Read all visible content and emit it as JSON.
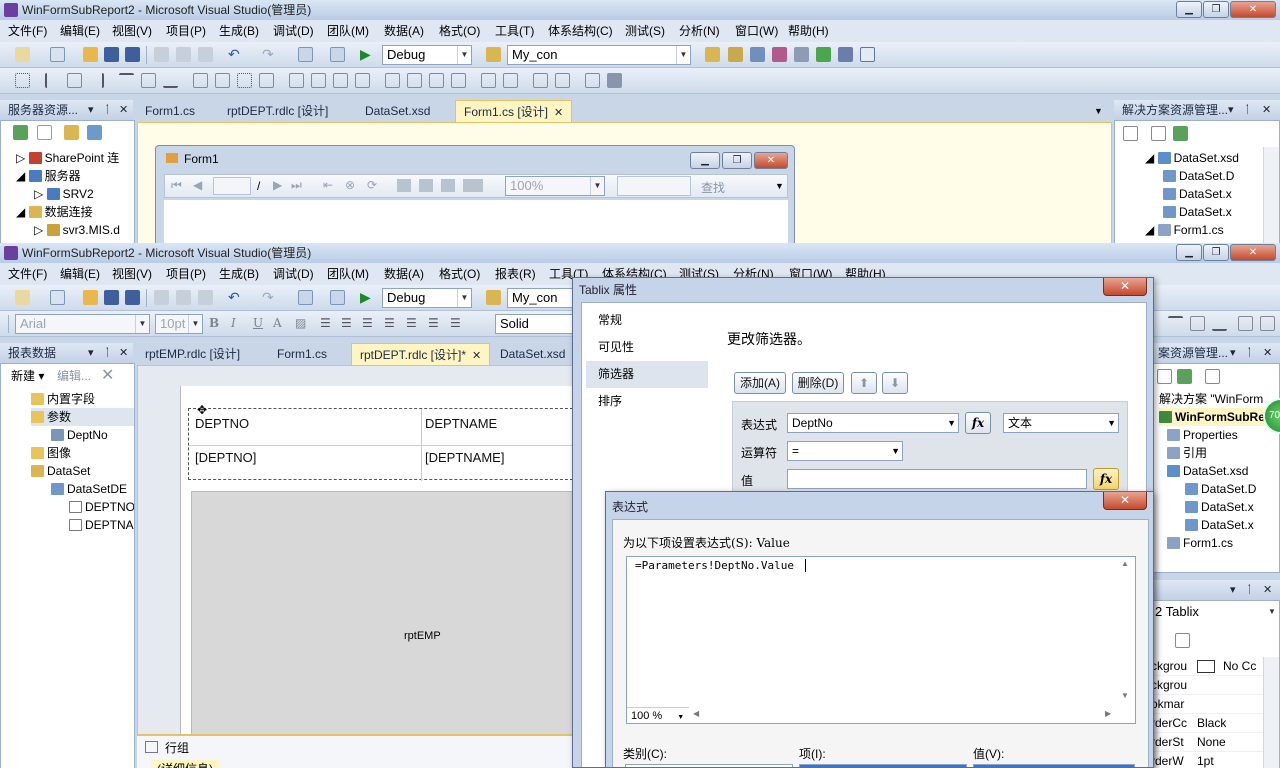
{
  "bg_window": {
    "title": "WinFormSubReport2 - Microsoft Visual Studio(管理员)",
    "menu": [
      "文件(F)",
      "编辑(E)",
      "视图(V)",
      "项目(P)",
      "生成(B)",
      "调试(D)",
      "团队(M)",
      "数据(A)",
      "格式(O)",
      "工具(T)",
      "体系结构(C)",
      "测试(S)",
      "分析(N)",
      "窗口(W)",
      "帮助(H)"
    ],
    "config": "Debug",
    "connection": "My_con",
    "server_explorer": {
      "title": "服务器资源...",
      "items": [
        "SharePoint 连",
        "服务器",
        "SRV2",
        "数据连接",
        "svr3.MIS.d"
      ]
    },
    "tabs": [
      "Form1.cs",
      "rptDEPT.rdlc [设计]",
      "DataSet.xsd",
      "Form1.cs [设计]"
    ],
    "form": {
      "title": "Form1",
      "page_sep": "/",
      "zoom": "100%",
      "find": "查找"
    },
    "solution": {
      "title": "解决方案资源管理...",
      "items": [
        "DataSet.xsd",
        "DataSet.D",
        "DataSet.x",
        "DataSet.x",
        "Form1.cs"
      ]
    }
  },
  "fg_window": {
    "title": "WinFormSubReport2 - Microsoft Visual Studio(管理员)",
    "menu": [
      "文件(F)",
      "编辑(E)",
      "视图(V)",
      "项目(P)",
      "生成(B)",
      "调试(D)",
      "团队(M)",
      "数据(A)",
      "格式(O)",
      "报表(R)",
      "工具(T)",
      "体系结构(C)",
      "测试(S)",
      "分析(N)",
      "窗口(W)",
      "帮助(H)"
    ],
    "config": "Debug",
    "connection": "My_con",
    "font": "Arial",
    "size": "10pt",
    "border_style": "Solid",
    "report_data": {
      "title": "报表数据",
      "new_label": "新建",
      "edit_label": "编辑...",
      "items": [
        "内置字段",
        "参数",
        "DeptNo",
        "图像",
        "DataSet",
        "DataSetDE",
        "DEPTNO",
        "DEPTNA"
      ]
    },
    "tabs": [
      "rptEMP.rdlc [设计]",
      "Form1.cs",
      "rptDEPT.rdlc [设计]*",
      "DataSet.xsd"
    ],
    "table": {
      "headers": [
        "DEPTNO",
        "DEPTNAME"
      ],
      "values": [
        "[DEPTNO]",
        "[DEPTNAME]"
      ],
      "subreport": "rptEMP"
    },
    "row_groups": "行组",
    "row_group_detail": "(详细信息)",
    "solution": {
      "title": "案资源管理...",
      "items": [
        "解决方案 \"WinForm",
        "WinFormSubRe",
        "Properties",
        "引用",
        "DataSet.xsd",
        "DataSet.D",
        "DataSet.x",
        "DataSet.x",
        "Form1.cs"
      ]
    },
    "properties": {
      "object": "2 Tablix",
      "rows": [
        {
          "name": "ckgrou",
          "value": "No Cc"
        },
        {
          "name": "ckgrou",
          "value": ""
        },
        {
          "name": "okmar",
          "value": ""
        },
        {
          "name": "rderCc",
          "value": "Black"
        },
        {
          "name": "rderSt",
          "value": "None"
        },
        {
          "name": "rderW",
          "value": "1pt"
        }
      ]
    }
  },
  "tablix_dialog": {
    "title": "Tablix 属性",
    "nav": [
      "常规",
      "可见性",
      "筛选器",
      "排序"
    ],
    "heading": "更改筛选器。",
    "add": "添加(A)",
    "delete": "删除(D)",
    "expr_label": "表达式",
    "expr_value": "DeptNo",
    "type_value": "文本",
    "op_label": "运算符",
    "op_value": "=",
    "val_label": "值"
  },
  "expression_dialog": {
    "title": "表达式",
    "prompt": "为以下项设置表达式(S): Value",
    "expression": "=Parameters!DeptNo.Value",
    "zoom": "100 %",
    "category_label": "类别(C):",
    "item_label": "项(I):",
    "value_label": "值(V):"
  },
  "badge": "70",
  "colors": {
    "accent": "#fff5c2",
    "titlebar": "#c9d6e8",
    "close": "#c34b2c"
  }
}
